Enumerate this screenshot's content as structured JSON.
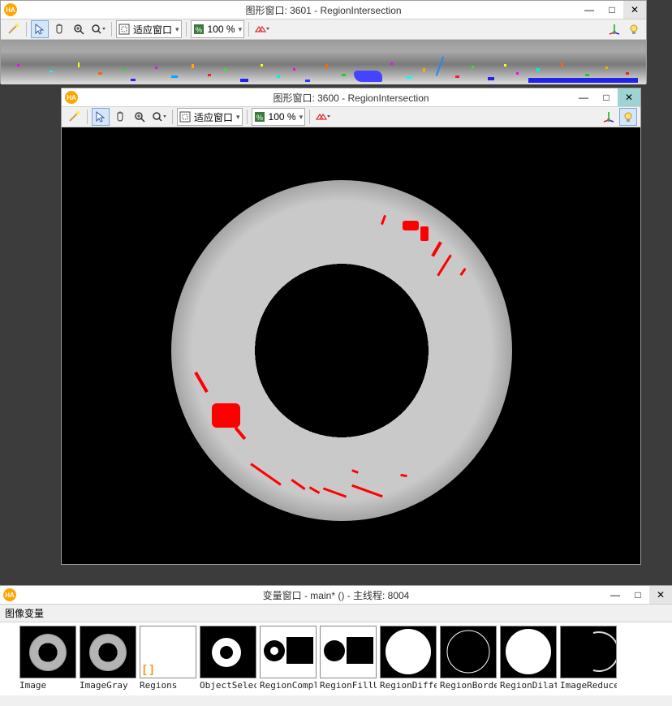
{
  "win1": {
    "title": "图形窗口: 3601 - RegionIntersection",
    "fit_label": "适应窗口",
    "zoom": "100 %"
  },
  "win2": {
    "title": "图形窗口: 3600 - RegionIntersection",
    "fit_label": "适应窗口",
    "zoom": "100 %"
  },
  "varwin": {
    "title": "变量窗口 - main* () - 主线程: 8004",
    "group_label": "图像变量",
    "items": [
      {
        "name": "Image"
      },
      {
        "name": "ImageGray"
      },
      {
        "name": "Regions"
      },
      {
        "name": "ObjectSelec"
      },
      {
        "name": "RegionCompl"
      },
      {
        "name": "RegionFillU"
      },
      {
        "name": "RegionDiffe"
      },
      {
        "name": "RegionBorde"
      },
      {
        "name": "RegionDilat"
      },
      {
        "name": "ImageReduce"
      }
    ]
  },
  "glyph": {
    "min": "—",
    "max": "□",
    "close": "✕",
    "dd": "▾"
  }
}
